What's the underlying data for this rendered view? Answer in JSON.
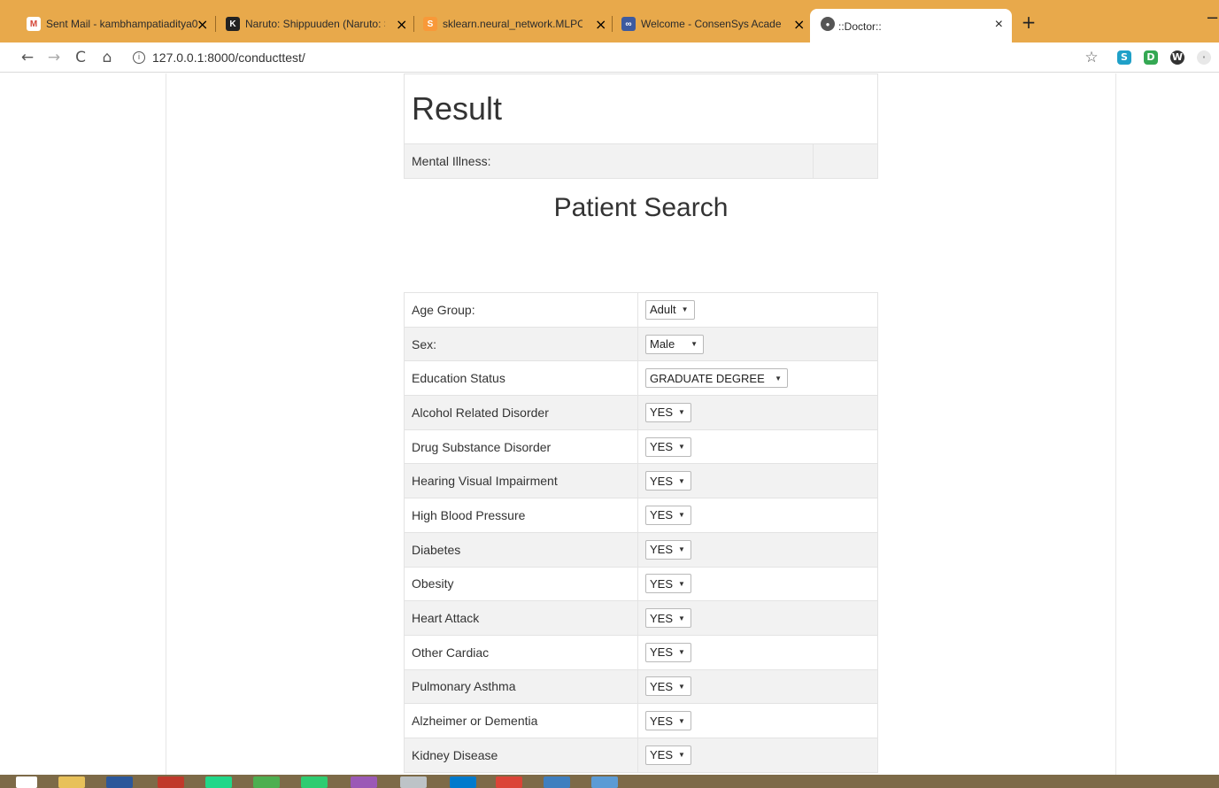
{
  "browser": {
    "tabs": [
      {
        "label": "Sent Mail - kambhampatiaditya0",
        "icon": "gmail-icon",
        "icon_color": "#d44638",
        "icon_glyph": "M"
      },
      {
        "label": "Naruto: Shippuuden (Naruto: Shi",
        "icon": "crunchyroll-icon",
        "icon_color": "#222222",
        "icon_glyph": "K"
      },
      {
        "label": "sklearn.neural_network.MLPClass",
        "icon": "sklearn-icon",
        "icon_color": "#f89939",
        "icon_glyph": "S"
      },
      {
        "label": "Welcome - ConsenSys Academy",
        "icon": "consensys-icon",
        "icon_color": "#3d5a9f",
        "icon_glyph": "∞"
      },
      {
        "label": "::Doctor::",
        "icon": "globe-icon",
        "icon_color": "#555555",
        "icon_glyph": "●",
        "active": true
      }
    ],
    "close_glyph": "×",
    "new_tab_glyph": "+",
    "minimize_glyph": "−",
    "url": "127.0.0.1:8000/conducttest/",
    "info_glyph": "i",
    "nav": {
      "back": "←",
      "forward": "→",
      "reload": "C",
      "home": "⌂",
      "star": "☆"
    },
    "extensions": [
      {
        "name": "s-extension-icon",
        "glyph": "S",
        "color": "#1fa0c8"
      },
      {
        "name": "d-extension-icon",
        "glyph": "D",
        "color": "#34a853"
      },
      {
        "name": "w-extension-icon",
        "glyph": "W",
        "color": "#333333"
      },
      {
        "name": "avatar-icon",
        "glyph": "·",
        "color": "#d9d9d9"
      }
    ]
  },
  "result": {
    "title": "Result",
    "mental_illness_label": "Mental Illness:",
    "mental_illness_value": ""
  },
  "search": {
    "title": "Patient Search",
    "fields": [
      {
        "label": "Age Group:",
        "value": "Adult"
      },
      {
        "label": "Sex:",
        "value": "Male"
      },
      {
        "label": "Education Status",
        "value": "GRADUATE DEGREE"
      },
      {
        "label": "Alcohol Related Disorder",
        "value": "YES"
      },
      {
        "label": "Drug Substance Disorder",
        "value": "YES"
      },
      {
        "label": "Hearing Visual Impairment",
        "value": "YES"
      },
      {
        "label": "High Blood Pressure",
        "value": "YES"
      },
      {
        "label": "Diabetes",
        "value": "YES"
      },
      {
        "label": "Obesity",
        "value": "YES"
      },
      {
        "label": "Heart Attack",
        "value": "YES"
      },
      {
        "label": "Other Cardiac",
        "value": "YES"
      },
      {
        "label": "Pulmonary Asthma",
        "value": "YES"
      },
      {
        "label": "Alzheimer or Dementia",
        "value": "YES"
      },
      {
        "label": "Kidney Disease",
        "value": "YES"
      }
    ],
    "caret_glyph": "▼"
  },
  "taskbar": {
    "icons": [
      {
        "name": "windows-start-icon",
        "color": "#ffffff"
      },
      {
        "name": "file-explorer-icon",
        "color": "#e8c15a"
      },
      {
        "name": "word-icon",
        "color": "#2b579a"
      },
      {
        "name": "app-icon-red",
        "color": "#c0392b"
      },
      {
        "name": "pycharm-icon",
        "color": "#21d789"
      },
      {
        "name": "app-icon-green",
        "color": "#4caf50"
      },
      {
        "name": "app-icon-green-2",
        "color": "#2ecc71"
      },
      {
        "name": "app-icon-purple",
        "color": "#9b59b6"
      },
      {
        "name": "app-icon-grey",
        "color": "#bdc3c7"
      },
      {
        "name": "vscode-icon",
        "color": "#007acc"
      },
      {
        "name": "chrome-icon",
        "color": "#db4437"
      },
      {
        "name": "app-icon-blue",
        "color": "#3f7fbf"
      },
      {
        "name": "app-icon-blue-2",
        "color": "#5b9bd5"
      }
    ]
  }
}
